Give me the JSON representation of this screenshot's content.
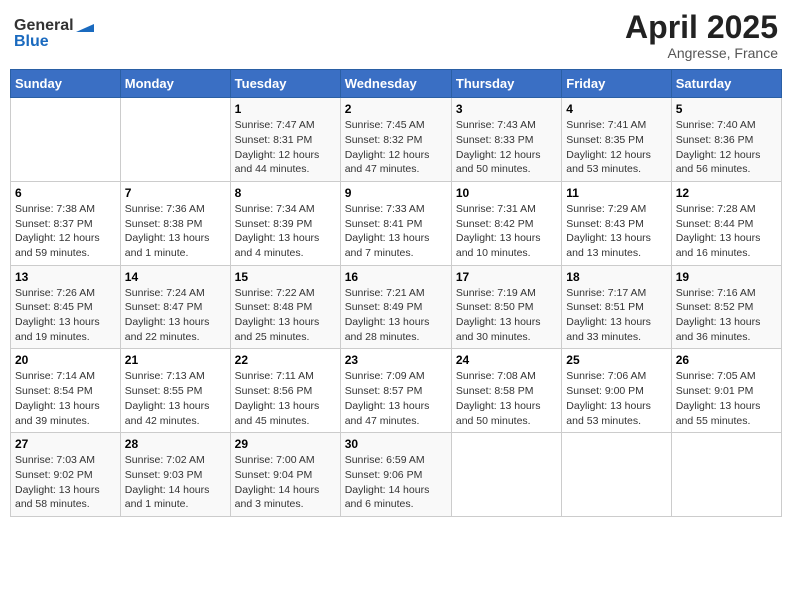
{
  "header": {
    "logo_general": "General",
    "logo_blue": "Blue",
    "month_year": "April 2025",
    "location": "Angresse, France"
  },
  "days_of_week": [
    "Sunday",
    "Monday",
    "Tuesday",
    "Wednesday",
    "Thursday",
    "Friday",
    "Saturday"
  ],
  "weeks": [
    [
      {
        "day": "",
        "info": ""
      },
      {
        "day": "",
        "info": ""
      },
      {
        "day": "1",
        "info": "Sunrise: 7:47 AM\nSunset: 8:31 PM\nDaylight: 12 hours and 44 minutes."
      },
      {
        "day": "2",
        "info": "Sunrise: 7:45 AM\nSunset: 8:32 PM\nDaylight: 12 hours and 47 minutes."
      },
      {
        "day": "3",
        "info": "Sunrise: 7:43 AM\nSunset: 8:33 PM\nDaylight: 12 hours and 50 minutes."
      },
      {
        "day": "4",
        "info": "Sunrise: 7:41 AM\nSunset: 8:35 PM\nDaylight: 12 hours and 53 minutes."
      },
      {
        "day": "5",
        "info": "Sunrise: 7:40 AM\nSunset: 8:36 PM\nDaylight: 12 hours and 56 minutes."
      }
    ],
    [
      {
        "day": "6",
        "info": "Sunrise: 7:38 AM\nSunset: 8:37 PM\nDaylight: 12 hours and 59 minutes."
      },
      {
        "day": "7",
        "info": "Sunrise: 7:36 AM\nSunset: 8:38 PM\nDaylight: 13 hours and 1 minute."
      },
      {
        "day": "8",
        "info": "Sunrise: 7:34 AM\nSunset: 8:39 PM\nDaylight: 13 hours and 4 minutes."
      },
      {
        "day": "9",
        "info": "Sunrise: 7:33 AM\nSunset: 8:41 PM\nDaylight: 13 hours and 7 minutes."
      },
      {
        "day": "10",
        "info": "Sunrise: 7:31 AM\nSunset: 8:42 PM\nDaylight: 13 hours and 10 minutes."
      },
      {
        "day": "11",
        "info": "Sunrise: 7:29 AM\nSunset: 8:43 PM\nDaylight: 13 hours and 13 minutes."
      },
      {
        "day": "12",
        "info": "Sunrise: 7:28 AM\nSunset: 8:44 PM\nDaylight: 13 hours and 16 minutes."
      }
    ],
    [
      {
        "day": "13",
        "info": "Sunrise: 7:26 AM\nSunset: 8:45 PM\nDaylight: 13 hours and 19 minutes."
      },
      {
        "day": "14",
        "info": "Sunrise: 7:24 AM\nSunset: 8:47 PM\nDaylight: 13 hours and 22 minutes."
      },
      {
        "day": "15",
        "info": "Sunrise: 7:22 AM\nSunset: 8:48 PM\nDaylight: 13 hours and 25 minutes."
      },
      {
        "day": "16",
        "info": "Sunrise: 7:21 AM\nSunset: 8:49 PM\nDaylight: 13 hours and 28 minutes."
      },
      {
        "day": "17",
        "info": "Sunrise: 7:19 AM\nSunset: 8:50 PM\nDaylight: 13 hours and 30 minutes."
      },
      {
        "day": "18",
        "info": "Sunrise: 7:17 AM\nSunset: 8:51 PM\nDaylight: 13 hours and 33 minutes."
      },
      {
        "day": "19",
        "info": "Sunrise: 7:16 AM\nSunset: 8:52 PM\nDaylight: 13 hours and 36 minutes."
      }
    ],
    [
      {
        "day": "20",
        "info": "Sunrise: 7:14 AM\nSunset: 8:54 PM\nDaylight: 13 hours and 39 minutes."
      },
      {
        "day": "21",
        "info": "Sunrise: 7:13 AM\nSunset: 8:55 PM\nDaylight: 13 hours and 42 minutes."
      },
      {
        "day": "22",
        "info": "Sunrise: 7:11 AM\nSunset: 8:56 PM\nDaylight: 13 hours and 45 minutes."
      },
      {
        "day": "23",
        "info": "Sunrise: 7:09 AM\nSunset: 8:57 PM\nDaylight: 13 hours and 47 minutes."
      },
      {
        "day": "24",
        "info": "Sunrise: 7:08 AM\nSunset: 8:58 PM\nDaylight: 13 hours and 50 minutes."
      },
      {
        "day": "25",
        "info": "Sunrise: 7:06 AM\nSunset: 9:00 PM\nDaylight: 13 hours and 53 minutes."
      },
      {
        "day": "26",
        "info": "Sunrise: 7:05 AM\nSunset: 9:01 PM\nDaylight: 13 hours and 55 minutes."
      }
    ],
    [
      {
        "day": "27",
        "info": "Sunrise: 7:03 AM\nSunset: 9:02 PM\nDaylight: 13 hours and 58 minutes."
      },
      {
        "day": "28",
        "info": "Sunrise: 7:02 AM\nSunset: 9:03 PM\nDaylight: 14 hours and 1 minute."
      },
      {
        "day": "29",
        "info": "Sunrise: 7:00 AM\nSunset: 9:04 PM\nDaylight: 14 hours and 3 minutes."
      },
      {
        "day": "30",
        "info": "Sunrise: 6:59 AM\nSunset: 9:06 PM\nDaylight: 14 hours and 6 minutes."
      },
      {
        "day": "",
        "info": ""
      },
      {
        "day": "",
        "info": ""
      },
      {
        "day": "",
        "info": ""
      }
    ]
  ]
}
